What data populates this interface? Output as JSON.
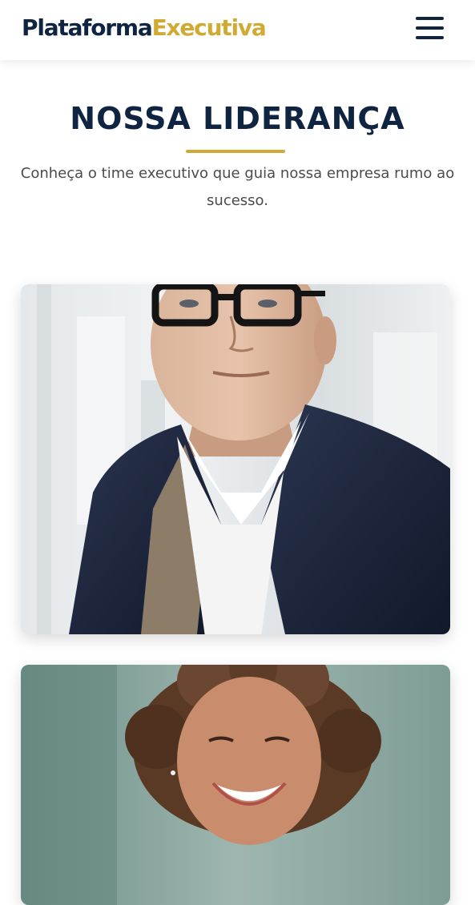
{
  "header": {
    "brand_part1": "Plataforma",
    "brand_part2": "Executiva",
    "menu_icon": "hamburger-menu-icon"
  },
  "section": {
    "title": "NOSSA LIDERANÇA",
    "subtitle": "Conheça o time executivo que guia nossa empresa rumo ao sucesso."
  },
  "colors": {
    "navy": "#0f2440",
    "gold": "#d0ab34",
    "text_gray": "#4b4b4b"
  },
  "team": [
    {
      "photo": "executive-portrait-man-glasses"
    },
    {
      "photo": "executive-portrait-woman-curly-hair"
    }
  ]
}
